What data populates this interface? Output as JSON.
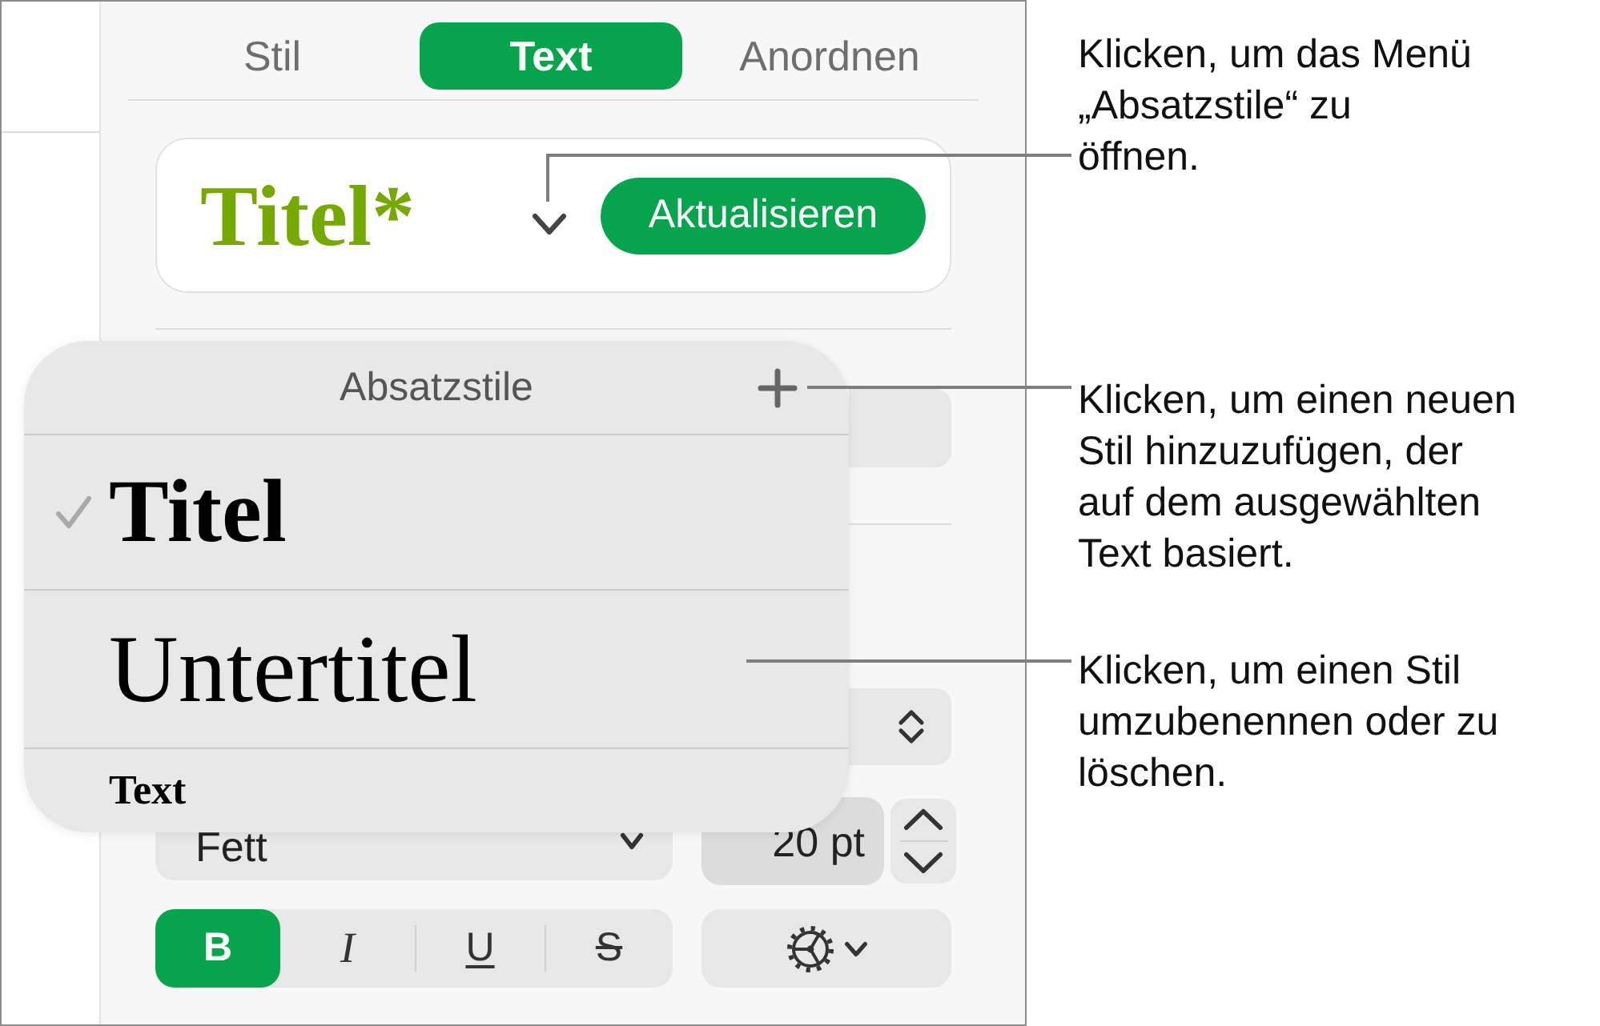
{
  "tabs": [
    {
      "label": "Stil",
      "selected": false
    },
    {
      "label": "Text",
      "selected": true
    },
    {
      "label": "Anordnen",
      "selected": false
    }
  ],
  "paragraph_style": {
    "name": "Titel*",
    "update_button": "Aktualisieren"
  },
  "styles_menu": {
    "title": "Absatzstile",
    "items": [
      {
        "label": "Titel",
        "kind": "title",
        "selected": true
      },
      {
        "label": "Untertitel",
        "kind": "subtitle",
        "selected": false
      },
      {
        "label": "Text",
        "kind": "body",
        "selected": false
      }
    ]
  },
  "font": {
    "weight": "Fett",
    "size": "20 pt"
  },
  "format_buttons": [
    {
      "label": "B",
      "kind": "bold",
      "selected": true
    },
    {
      "label": "I",
      "kind": "italic",
      "selected": false
    },
    {
      "label": "U",
      "kind": "underline",
      "selected": false
    },
    {
      "label": "S",
      "kind": "strikethrough",
      "selected": false
    }
  ],
  "callouts": [
    {
      "text": "Klicken, um das Menü „Absatzstile“ zu öffnen."
    },
    {
      "text": "Klicken, um einen neuen Stil hinzuzufügen, der auf dem ausgewählten Text basiert."
    },
    {
      "text": "Klicken, um einen Stil umzubenennen oder zu löschen."
    }
  ]
}
